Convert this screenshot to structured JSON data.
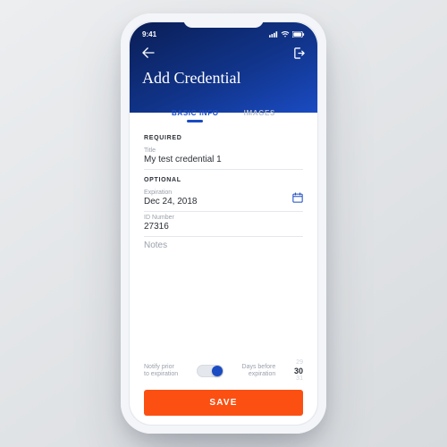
{
  "status": {
    "time": "9:41"
  },
  "header": {
    "title": "Add Credential"
  },
  "tabs": [
    {
      "label": "BASIC INFO",
      "active": true
    },
    {
      "label": "IMAGES",
      "active": false
    }
  ],
  "sections": {
    "required_label": "REQUIRED",
    "optional_label": "OPTIONAL"
  },
  "fields": {
    "title": {
      "label": "Title",
      "value": "My test credential 1"
    },
    "expiration": {
      "label": "Expiration",
      "value": "Dec 24, 2018"
    },
    "id_number": {
      "label": "ID Number",
      "value": "27316"
    },
    "notes": {
      "placeholder": "Notes"
    }
  },
  "notify": {
    "left_line1": "Notify prior",
    "left_line2": "to expiration",
    "right_line1": "Days before",
    "right_line2": "expiration",
    "toggle_on": true,
    "days_prev": "29",
    "days_value": "30",
    "days_next": "31"
  },
  "actions": {
    "save": "SAVE"
  },
  "colors": {
    "accent": "#1a4bc2",
    "primary_action": "#fb5012"
  }
}
